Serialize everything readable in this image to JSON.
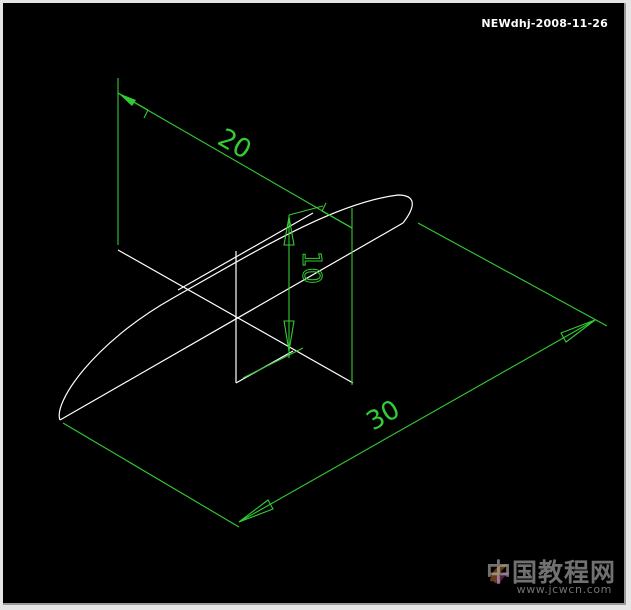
{
  "header": {
    "stamp": "NEWdhj-2008-11-26"
  },
  "drawing": {
    "dimensions": [
      {
        "id": "dim-20",
        "value": "20"
      },
      {
        "id": "dim-10",
        "value": "10"
      },
      {
        "id": "dim-30",
        "value": "30"
      }
    ],
    "colors": {
      "background": "#000000",
      "geometry": "#ffffff",
      "dimension": "#33cc33"
    }
  },
  "watermark": {
    "title": "中国教程网",
    "url": "www.jcwcn.com"
  }
}
